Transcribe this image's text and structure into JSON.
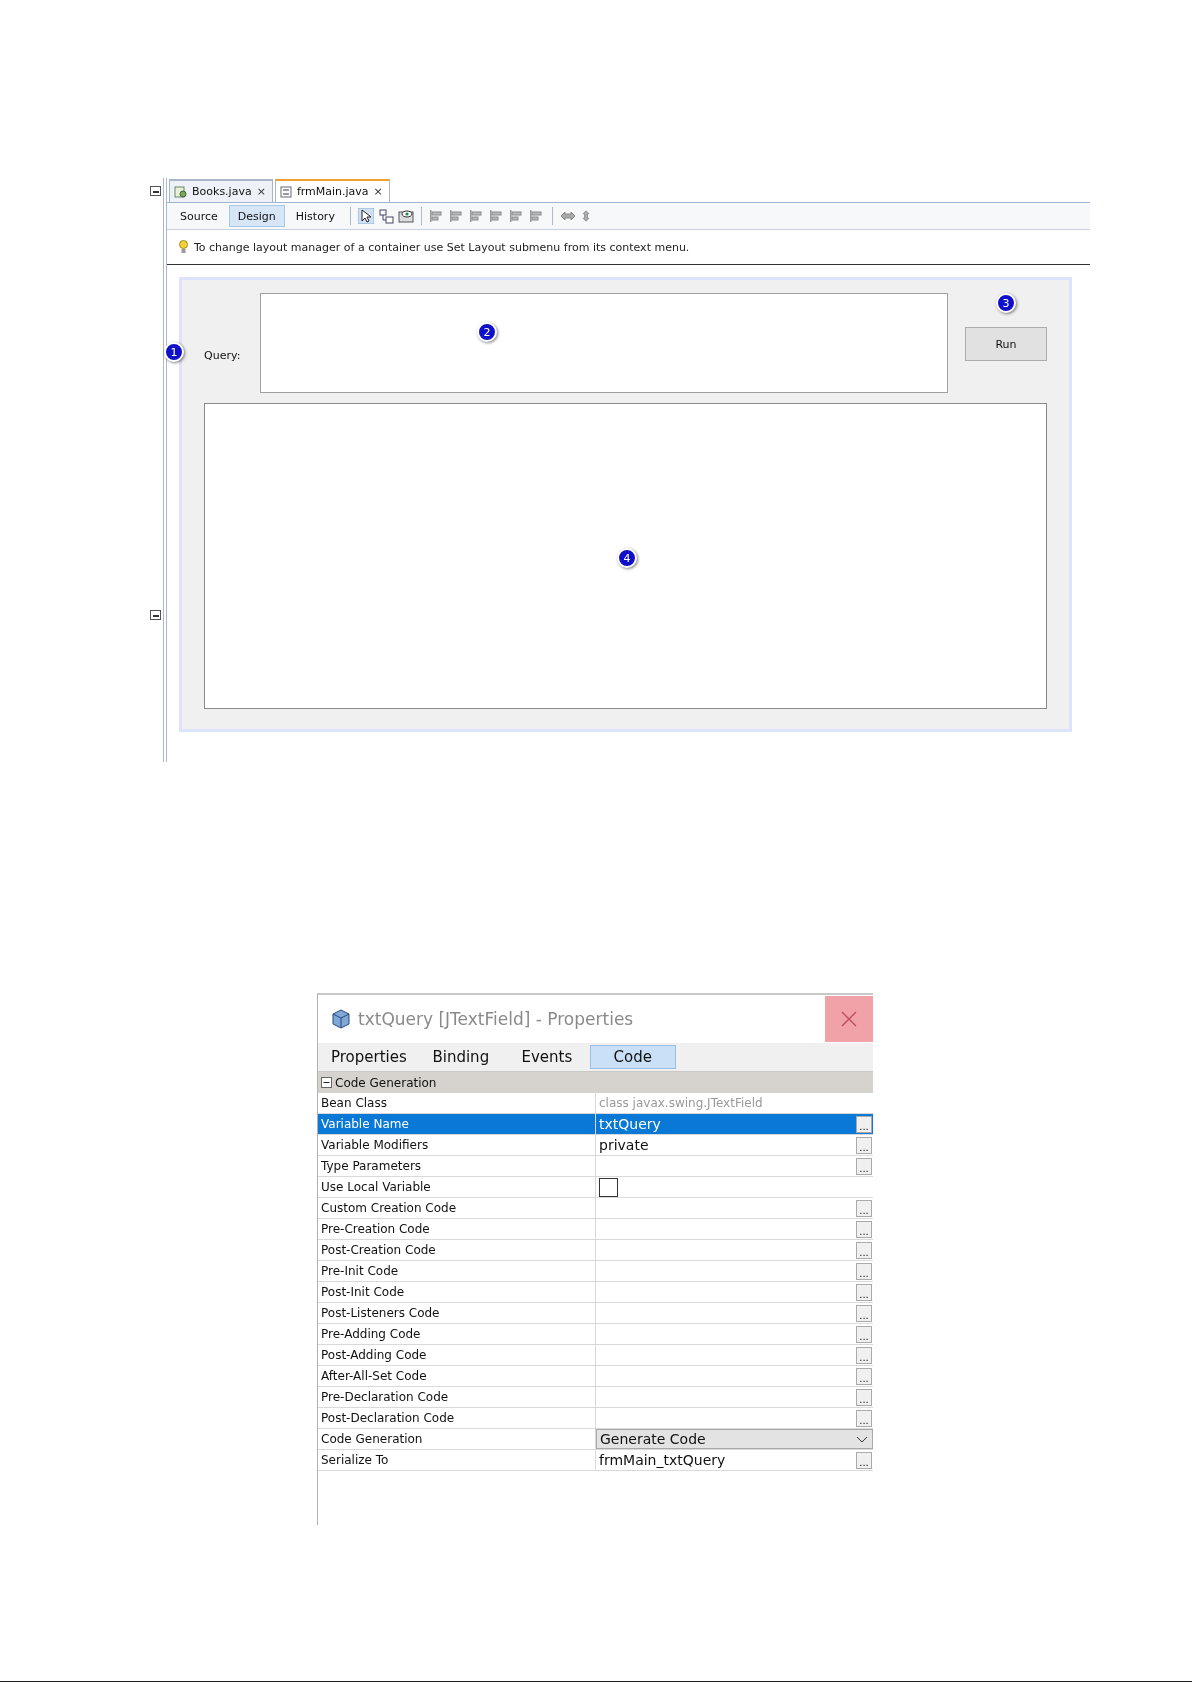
{
  "designer": {
    "file_tabs": [
      {
        "label": "Books.java",
        "close": "×",
        "selected": false,
        "kind": "class"
      },
      {
        "label": "frmMain.java",
        "close": "×",
        "selected": true,
        "kind": "form"
      }
    ],
    "view_tabs": [
      {
        "label": "Source",
        "selected": false
      },
      {
        "label": "Design",
        "selected": true
      },
      {
        "label": "History",
        "selected": false
      }
    ],
    "hint": "To change layout manager of a container use Set Layout submenu from its context menu.",
    "form": {
      "query_label": "Query:",
      "run_button": "Run",
      "callouts": [
        "1",
        "2",
        "3",
        "4"
      ]
    }
  },
  "properties_window": {
    "title": "txtQuery [JTextField] - Properties",
    "tabs": [
      {
        "label": "Properties",
        "selected": false
      },
      {
        "label": "Binding",
        "selected": false
      },
      {
        "label": "Events",
        "selected": false
      },
      {
        "label": "Code",
        "selected": true
      }
    ],
    "group": {
      "label": "Code Generation",
      "expanded": true
    },
    "rows": [
      {
        "name": "Bean Class",
        "value": "class javax.swing.JTextField",
        "kind": "readonly",
        "selected": false
      },
      {
        "name": "Variable Name",
        "value": "txtQuery",
        "kind": "text",
        "selected": true,
        "editor": "..."
      },
      {
        "name": "Variable Modifiers",
        "value": "private",
        "kind": "text",
        "selected": false,
        "editor": "..."
      },
      {
        "name": "Type Parameters",
        "kind": "text",
        "selected": false,
        "editor": "..."
      },
      {
        "name": "Use Local Variable",
        "kind": "checkbox",
        "checked": false,
        "selected": false
      },
      {
        "name": "Custom Creation Code",
        "kind": "text",
        "selected": false,
        "editor": "..."
      },
      {
        "name": "Pre-Creation Code",
        "kind": "text",
        "selected": false,
        "editor": "..."
      },
      {
        "name": "Post-Creation Code",
        "kind": "text",
        "selected": false,
        "editor": "..."
      },
      {
        "name": "Pre-Init Code",
        "kind": "text",
        "selected": false,
        "editor": "..."
      },
      {
        "name": "Post-Init Code",
        "kind": "text",
        "selected": false,
        "editor": "..."
      },
      {
        "name": "Post-Listeners Code",
        "kind": "text",
        "selected": false,
        "editor": "..."
      },
      {
        "name": "Pre-Adding Code",
        "kind": "text",
        "selected": false,
        "editor": "..."
      },
      {
        "name": "Post-Adding Code",
        "kind": "text",
        "selected": false,
        "editor": "..."
      },
      {
        "name": "After-All-Set Code",
        "kind": "text",
        "selected": false,
        "editor": "..."
      },
      {
        "name": "Pre-Declaration Code",
        "kind": "text",
        "selected": false,
        "editor": "..."
      },
      {
        "name": "Post-Declaration Code",
        "kind": "text",
        "selected": false,
        "editor": "..."
      },
      {
        "name": "Code Generation",
        "value": "Generate Code",
        "kind": "combo",
        "selected": false
      },
      {
        "name": "Serialize To",
        "value": "frmMain_txtQuery",
        "kind": "text",
        "selected": false,
        "editor": "..."
      }
    ]
  }
}
